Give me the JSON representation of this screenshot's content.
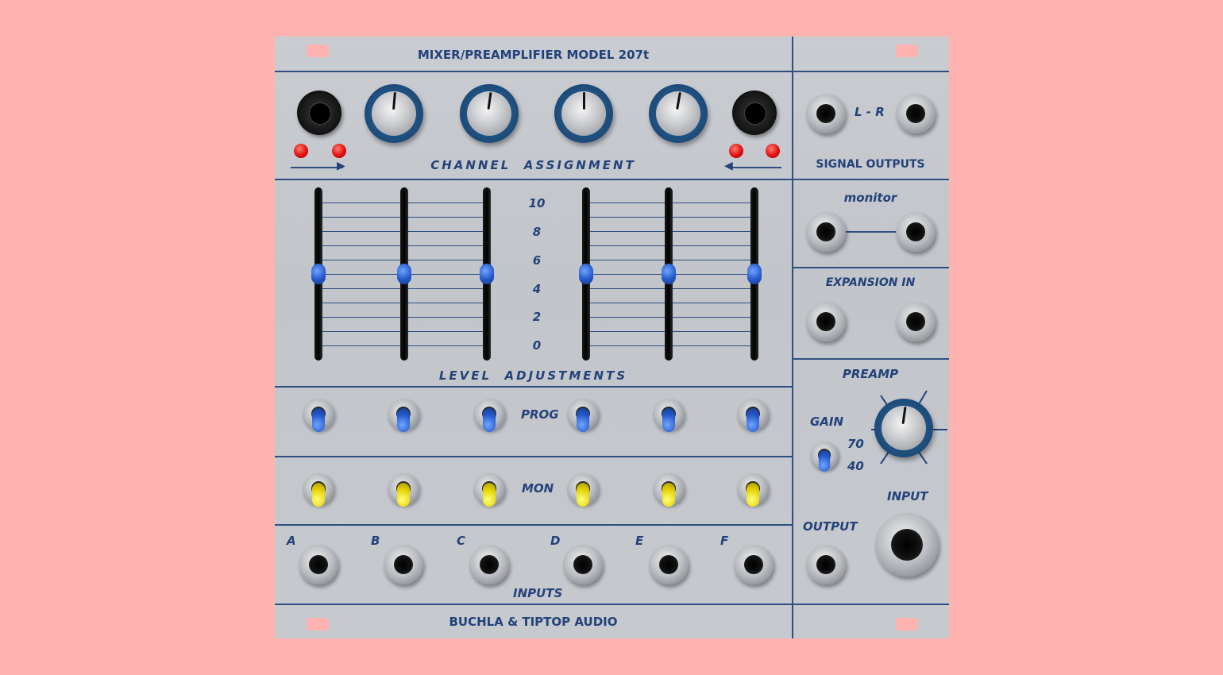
{
  "colors": {
    "background": "#ffb3b1",
    "panel": "#c6c9ce",
    "ink": "#23427a"
  },
  "header": {
    "title": "MIXER/PREAMPLIFIER MODEL 207t"
  },
  "footer": {
    "brand": "BUCHLA & TIPTOP AUDIO"
  },
  "channel_assignment": {
    "label": "CHANNEL  ASSIGNMENT",
    "knobs": 4,
    "sockets": 2,
    "leds": 4
  },
  "level_adjustments": {
    "label": "LEVEL  ADJUSTMENTS",
    "scale": [
      "10",
      "8",
      "6",
      "4",
      "2",
      "0"
    ],
    "fader_values": [
      5,
      5,
      5,
      5,
      5,
      5
    ]
  },
  "prog": {
    "label": "PROG"
  },
  "mon": {
    "label": "MON"
  },
  "inputs": {
    "label": "INPUTS",
    "channels": [
      "A",
      "B",
      "C",
      "D",
      "E",
      "F"
    ]
  },
  "right": {
    "lr_label": "L - R",
    "signal_outputs": "SIGNAL OUTPUTS",
    "monitor": "monitor",
    "expansion_in": "EXPANSION IN",
    "preamp": "PREAMP",
    "gain": "GAIN",
    "gain_hi": "70",
    "gain_lo": "40",
    "output": "OUTPUT",
    "input": "INPUT"
  }
}
